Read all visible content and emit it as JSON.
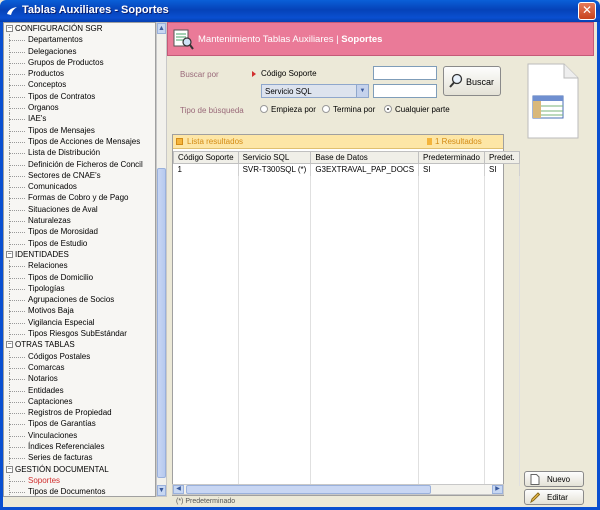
{
  "window": {
    "title": "Tablas Auxiliares - Soportes",
    "close_glyph": "✕"
  },
  "tree": {
    "groups": [
      {
        "label": "CONFIGURACIÓN SGR",
        "children": [
          "Departamentos",
          "Delegaciones",
          "Grupos de Productos",
          "Productos",
          "Conceptos",
          "Tipos de Contratos",
          "Organos",
          "IAE's",
          "Tipos de Mensajes",
          "Tipos de Acciones de Mensajes",
          "Lista de Distribución",
          "Definición de Ficheros de Concil",
          "Sectores de CNAE's",
          "Comunicados",
          "Formas de Cobro y de Pago",
          "Situaciones de Aval",
          "Naturalezas",
          "Tipos de Morosidad",
          "Tipos de Estudio"
        ]
      },
      {
        "label": "IDENTIDADES",
        "children": [
          "Relaciones",
          "Tipos de Domicilio",
          "Tipologías",
          "Agrupaciones de Socios",
          "Motivos Baja",
          "Vigilancia Especial",
          "Tipos Riesgos SubEstándar"
        ]
      },
      {
        "label": "OTRAS TABLAS",
        "children": [
          "Códigos Postales",
          "Comarcas",
          "Notarios",
          "Entidades",
          "Captaciones",
          "Registros de Propiedad",
          "Tipos de Garantías",
          "Vinculaciones",
          "Índices Referenciales",
          "Series de facturas"
        ]
      },
      {
        "label": "GESTIÓN DOCUMENTAL",
        "children": [
          "Soportes",
          "Tipos de Documentos"
        ]
      }
    ],
    "selected": "Soportes"
  },
  "header": {
    "title_prefix": "Mantenimiento Tablas Auxiliares | ",
    "title_bold": "Soportes"
  },
  "search": {
    "buscar_por_label": "Buscar por",
    "codigo_label": "Código Soporte",
    "codigo_value": "",
    "servicio_selected": "Servicio SQL",
    "servicio_value": "",
    "tipo_busqueda_label": "Tipo de búsqueda",
    "options": [
      "Empieza por",
      "Termina por",
      "Cualquier parte"
    ],
    "checked_option": "Cualquier parte",
    "button_label": "Buscar"
  },
  "results": {
    "header_label": "Lista resultados",
    "count_label": "1 Resultados",
    "columns": [
      "Código Soporte",
      "Servicio SQL",
      "Base de Datos",
      "Predeterminado",
      "Predet."
    ],
    "rows": [
      [
        "1",
        "SVR-T300SQL (*)",
        "G3EXTRAVAL_PAP_DOCS",
        "SI",
        "SI"
      ]
    ]
  },
  "footer_note": "(*) Predeterminado",
  "side_buttons": {
    "nuevo": "Nuevo",
    "editar": "Editar"
  },
  "colors": {
    "header_band": "#ea7a98",
    "titlebar": "#0542b8",
    "selected_item": "#d12f2f",
    "results_header": "#fde6a6"
  }
}
